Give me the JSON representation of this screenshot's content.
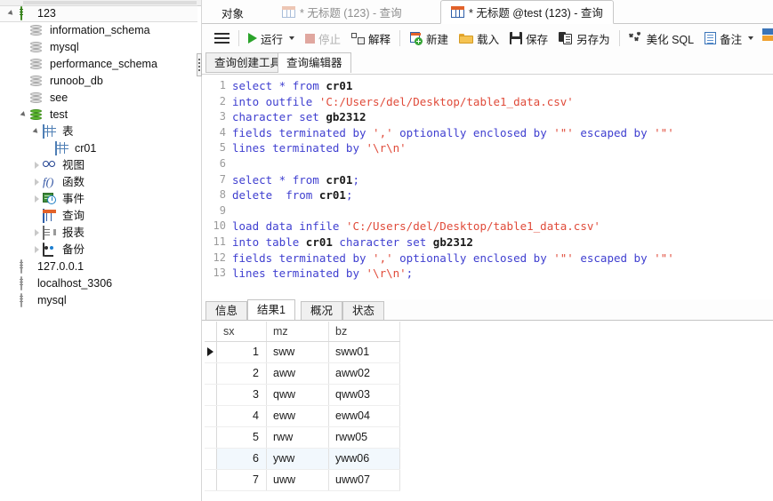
{
  "tree": {
    "nodes": [
      {
        "label": "123",
        "icon": "server-green-icon",
        "depth": 0,
        "arrow": "open",
        "selected": true
      },
      {
        "label": "information_schema",
        "icon": "database-grey-icon",
        "depth": 1,
        "arrow": "none",
        "selected": false
      },
      {
        "label": "mysql",
        "icon": "database-grey-icon",
        "depth": 1,
        "arrow": "none",
        "selected": false
      },
      {
        "label": "performance_schema",
        "icon": "database-grey-icon",
        "depth": 1,
        "arrow": "none",
        "selected": false
      },
      {
        "label": "runoob_db",
        "icon": "database-grey-icon",
        "depth": 1,
        "arrow": "none",
        "selected": false
      },
      {
        "label": "see",
        "icon": "database-grey-icon",
        "depth": 1,
        "arrow": "none",
        "selected": false
      },
      {
        "label": "test",
        "icon": "database-green-icon",
        "depth": 1,
        "arrow": "open",
        "selected": false
      },
      {
        "label": "表",
        "icon": "table-folder-icon",
        "depth": 2,
        "arrow": "open",
        "selected": false
      },
      {
        "label": "cr01",
        "icon": "table-icon",
        "depth": 3,
        "arrow": "none",
        "selected": false
      },
      {
        "label": "视图",
        "icon": "view-icon",
        "depth": 2,
        "arrow": "closed",
        "selected": false
      },
      {
        "label": "函数",
        "icon": "function-icon",
        "depth": 2,
        "arrow": "closed",
        "selected": false
      },
      {
        "label": "事件",
        "icon": "event-icon",
        "depth": 2,
        "arrow": "closed",
        "selected": false
      },
      {
        "label": "查询",
        "icon": "query-icon",
        "depth": 2,
        "arrow": "none",
        "selected": false
      },
      {
        "label": "报表",
        "icon": "report-icon",
        "depth": 2,
        "arrow": "closed",
        "selected": false
      },
      {
        "label": "备份",
        "icon": "backup-icon",
        "depth": 2,
        "arrow": "closed",
        "selected": false
      },
      {
        "label": "127.0.0.1",
        "icon": "server-grey-icon",
        "depth": 0,
        "arrow": "none",
        "selected": false
      },
      {
        "label": "localhost_3306",
        "icon": "server-grey-icon",
        "depth": 0,
        "arrow": "none",
        "selected": false
      },
      {
        "label": "mysql",
        "icon": "server-grey-icon",
        "depth": 0,
        "arrow": "none",
        "selected": false
      }
    ]
  },
  "tabbar": {
    "object_label": "对象",
    "tabs": [
      {
        "title": "* 无标题 (123) - 查询",
        "active": false
      },
      {
        "title": "* 无标题 @test (123) - 查询",
        "active": true
      }
    ]
  },
  "toolbar": {
    "menu_icon": "hamburger-icon",
    "items": [
      {
        "label": "运行",
        "icon": "play-icon",
        "dropdown": true,
        "disabled": false
      },
      {
        "label": "停止",
        "icon": "stop-icon",
        "dropdown": false,
        "disabled": true
      },
      {
        "label": "解释",
        "icon": "explain-icon",
        "dropdown": false,
        "disabled": false
      },
      {
        "label": "新建",
        "icon": "new-query-icon",
        "dropdown": false,
        "disabled": false
      },
      {
        "label": "载入",
        "icon": "folder-open-icon",
        "dropdown": false,
        "disabled": false
      },
      {
        "label": "保存",
        "icon": "save-icon",
        "dropdown": false,
        "disabled": false
      },
      {
        "label": "另存为",
        "icon": "save-as-icon",
        "dropdown": false,
        "disabled": false
      },
      {
        "label": "美化 SQL",
        "icon": "beautify-icon",
        "dropdown": false,
        "disabled": false
      },
      {
        "label": "备注",
        "icon": "comment-icon",
        "dropdown": true,
        "disabled": false
      }
    ]
  },
  "subtabs": [
    {
      "label": "查询创建工具",
      "active": false
    },
    {
      "label": "查询编辑器",
      "active": true
    }
  ],
  "editor": {
    "lines": [
      {
        "n": "1",
        "tokens": [
          {
            "t": "select * from ",
            "c": "kw"
          },
          {
            "t": "cr01",
            "c": "id"
          }
        ]
      },
      {
        "n": "2",
        "tokens": [
          {
            "t": "into outfile ",
            "c": "kw"
          },
          {
            "t": "'C:/Users/del/Desktop/table1_data.csv'",
            "c": "str"
          }
        ]
      },
      {
        "n": "3",
        "tokens": [
          {
            "t": "character set ",
            "c": "kw"
          },
          {
            "t": "gb2312",
            "c": "id"
          }
        ]
      },
      {
        "n": "4",
        "tokens": [
          {
            "t": "fields terminated by ",
            "c": "kw"
          },
          {
            "t": "','",
            "c": "str"
          },
          {
            "t": " optionally enclosed by ",
            "c": "kw"
          },
          {
            "t": "'\"'",
            "c": "str"
          },
          {
            "t": " escaped by ",
            "c": "kw"
          },
          {
            "t": "'\"'",
            "c": "str"
          }
        ]
      },
      {
        "n": "5",
        "tokens": [
          {
            "t": "lines terminated by ",
            "c": "kw"
          },
          {
            "t": "'\\r\\n'",
            "c": "str"
          }
        ]
      },
      {
        "n": "6",
        "tokens": [
          {
            "t": "",
            "c": "kw"
          }
        ]
      },
      {
        "n": "7",
        "tokens": [
          {
            "t": "select * from ",
            "c": "kw"
          },
          {
            "t": "cr01",
            "c": "id"
          },
          {
            "t": ";",
            "c": "kw"
          }
        ]
      },
      {
        "n": "8",
        "tokens": [
          {
            "t": "delete  from ",
            "c": "kw"
          },
          {
            "t": "cr01",
            "c": "id"
          },
          {
            "t": ";",
            "c": "kw"
          }
        ]
      },
      {
        "n": "9",
        "tokens": [
          {
            "t": "",
            "c": "kw"
          }
        ]
      },
      {
        "n": "10",
        "tokens": [
          {
            "t": "load data infile ",
            "c": "kw"
          },
          {
            "t": "'C:/Users/del/Desktop/table1_data.csv'",
            "c": "str"
          }
        ]
      },
      {
        "n": "11",
        "tokens": [
          {
            "t": "into table ",
            "c": "kw"
          },
          {
            "t": "cr01",
            "c": "id"
          },
          {
            "t": " character set ",
            "c": "kw"
          },
          {
            "t": "gb2312",
            "c": "id"
          }
        ]
      },
      {
        "n": "12",
        "tokens": [
          {
            "t": "fields terminated by ",
            "c": "kw"
          },
          {
            "t": "','",
            "c": "str"
          },
          {
            "t": " optionally enclosed by ",
            "c": "kw"
          },
          {
            "t": "'\"'",
            "c": "str"
          },
          {
            "t": " escaped by ",
            "c": "kw"
          },
          {
            "t": "'\"'",
            "c": "str"
          }
        ]
      },
      {
        "n": "13",
        "tokens": [
          {
            "t": "lines terminated by ",
            "c": "kw"
          },
          {
            "t": "'\\r\\n'",
            "c": "str"
          },
          {
            "t": ";",
            "c": "kw"
          }
        ]
      }
    ]
  },
  "result_tabs": [
    {
      "label": "信息",
      "active": false
    },
    {
      "label": "结果1",
      "active": true
    },
    {
      "label": "概况",
      "active": false
    },
    {
      "label": "状态",
      "active": false
    }
  ],
  "result_grid": {
    "columns": [
      "sx",
      "mz",
      "bz"
    ],
    "rows": [
      {
        "sx": "1",
        "mz": "sww",
        "bz": "sww01",
        "current": true,
        "highlight": false
      },
      {
        "sx": "2",
        "mz": "aww",
        "bz": "aww02",
        "current": false,
        "highlight": false
      },
      {
        "sx": "3",
        "mz": "qww",
        "bz": "qww03",
        "current": false,
        "highlight": false
      },
      {
        "sx": "4",
        "mz": "eww",
        "bz": "eww04",
        "current": false,
        "highlight": false
      },
      {
        "sx": "5",
        "mz": "rww",
        "bz": "rww05",
        "current": false,
        "highlight": false
      },
      {
        "sx": "6",
        "mz": "yww",
        "bz": "yww06",
        "current": false,
        "highlight": true
      },
      {
        "sx": "7",
        "mz": "uww",
        "bz": "uww07",
        "current": false,
        "highlight": false
      }
    ]
  },
  "colors": {
    "keyword": "#3f3fd0",
    "string": "#e04b3a",
    "identifier": "#1a1a1a",
    "gutter": "#9b9b9b",
    "accent_green": "#2aa32a",
    "row_highlight": "#f2f8fd"
  }
}
